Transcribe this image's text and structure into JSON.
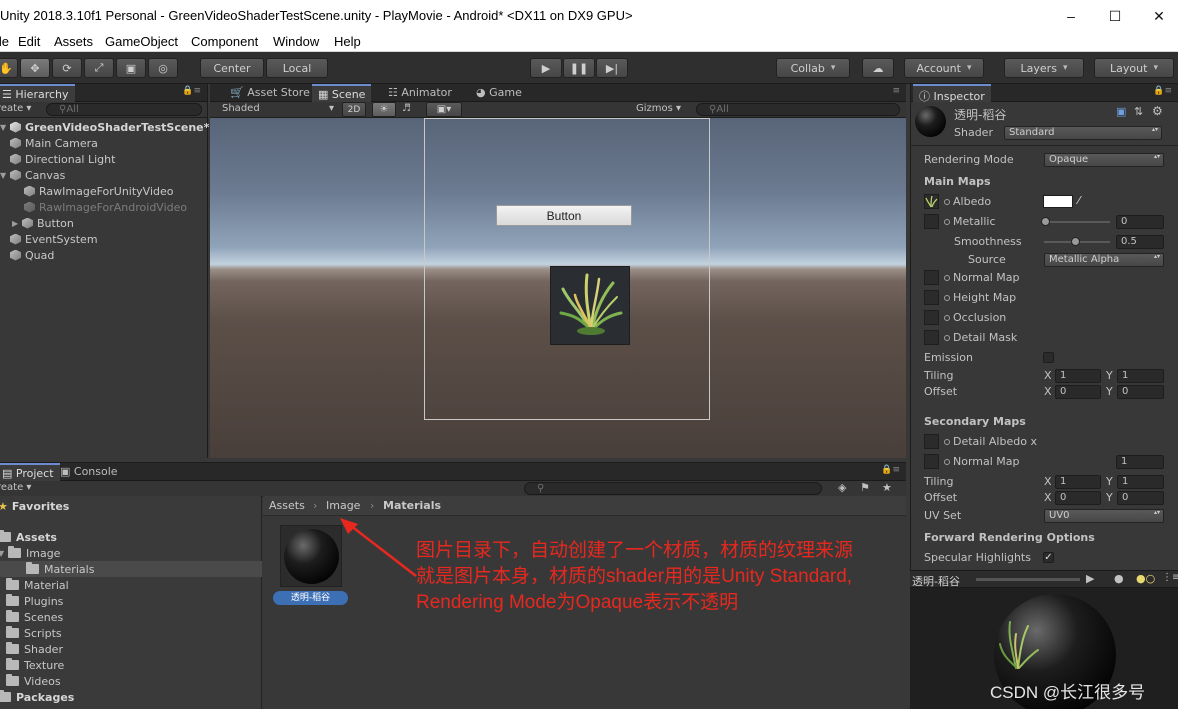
{
  "window": {
    "title": "Unity 2018.3.10f1 Personal - GreenVideoShaderTestScene.unity - PlayMovie - Android* <DX11 on DX9 GPU>"
  },
  "menu": [
    "File",
    "Edit",
    "Assets",
    "GameObject",
    "Component",
    "Window",
    "Help"
  ],
  "toolbar": {
    "pivot_center": "Center",
    "pivot_local": "Local",
    "collab": "Collab",
    "account": "Account",
    "layers": "Layers",
    "layout": "Layout"
  },
  "hierarchy": {
    "tab": "Hierarchy",
    "create": "Create",
    "search_placeholder": "All",
    "scene_name": "GreenVideoShaderTestScene*",
    "items": [
      "Main Camera",
      "Directional Light",
      "Canvas",
      "RawImageForUnityVideo",
      "RawImageForAndroidVideo",
      "Button",
      "EventSystem",
      "Quad"
    ]
  },
  "scene": {
    "tabs": [
      "Asset Store",
      "Scene",
      "Animator",
      "Game"
    ],
    "shading": "Shaded",
    "mode_2d": "2D",
    "gizmos": "Gizmos",
    "search_placeholder": "All",
    "ui_button_text": "Button"
  },
  "project": {
    "tabs": [
      "Project",
      "Console"
    ],
    "create": "Create",
    "favorites": "Favorites",
    "assets": "Assets",
    "tree": [
      "Image",
      "Materials",
      "Material",
      "Plugins",
      "Scenes",
      "Scripts",
      "Shader",
      "Texture",
      "Videos"
    ],
    "packages": "Packages",
    "breadcrumb": [
      "Assets",
      "Image",
      "Materials"
    ],
    "asset_name": "透明-稻谷"
  },
  "annotation": {
    "line1": "图片目录下，自动创建了一个材质，材质的纹理来源",
    "line2": "就是图片本身，材质的shader用的是Unity Standard,",
    "line3": "Rendering Mode为Opaque表示不透明"
  },
  "inspector": {
    "tab": "Inspector",
    "material_name": "透明-稻谷",
    "shader_label": "Shader",
    "shader_value": "Standard",
    "rendering_mode_label": "Rendering Mode",
    "rendering_mode_value": "Opaque",
    "main_maps": "Main Maps",
    "albedo": "Albedo",
    "metallic": "Metallic",
    "metallic_value": "0",
    "smoothness": "Smoothness",
    "smoothness_value": "0.5",
    "source": "Source",
    "source_value": "Metallic Alpha",
    "normal_map": "Normal Map",
    "height_map": "Height Map",
    "occlusion": "Occlusion",
    "detail_mask": "Detail Mask",
    "emission": "Emission",
    "tiling": "Tiling",
    "offset": "Offset",
    "x": "X",
    "y": "Y",
    "tiling_x": "1",
    "tiling_y": "1",
    "offset_x": "0",
    "offset_y": "0",
    "secondary_maps": "Secondary Maps",
    "detail_albedo": "Detail Albedo x",
    "normal_map2": "Normal Map",
    "normal_scale": "1",
    "tiling2_x": "1",
    "tiling2_y": "1",
    "offset2_x": "0",
    "offset2_y": "0",
    "uv_set": "UV Set",
    "uv_set_value": "UV0",
    "forward_options": "Forward Rendering Options",
    "specular_highlights": "Specular Highlights",
    "preview_name": "透明-稻谷"
  },
  "watermark": "CSDN @长江很多号"
}
